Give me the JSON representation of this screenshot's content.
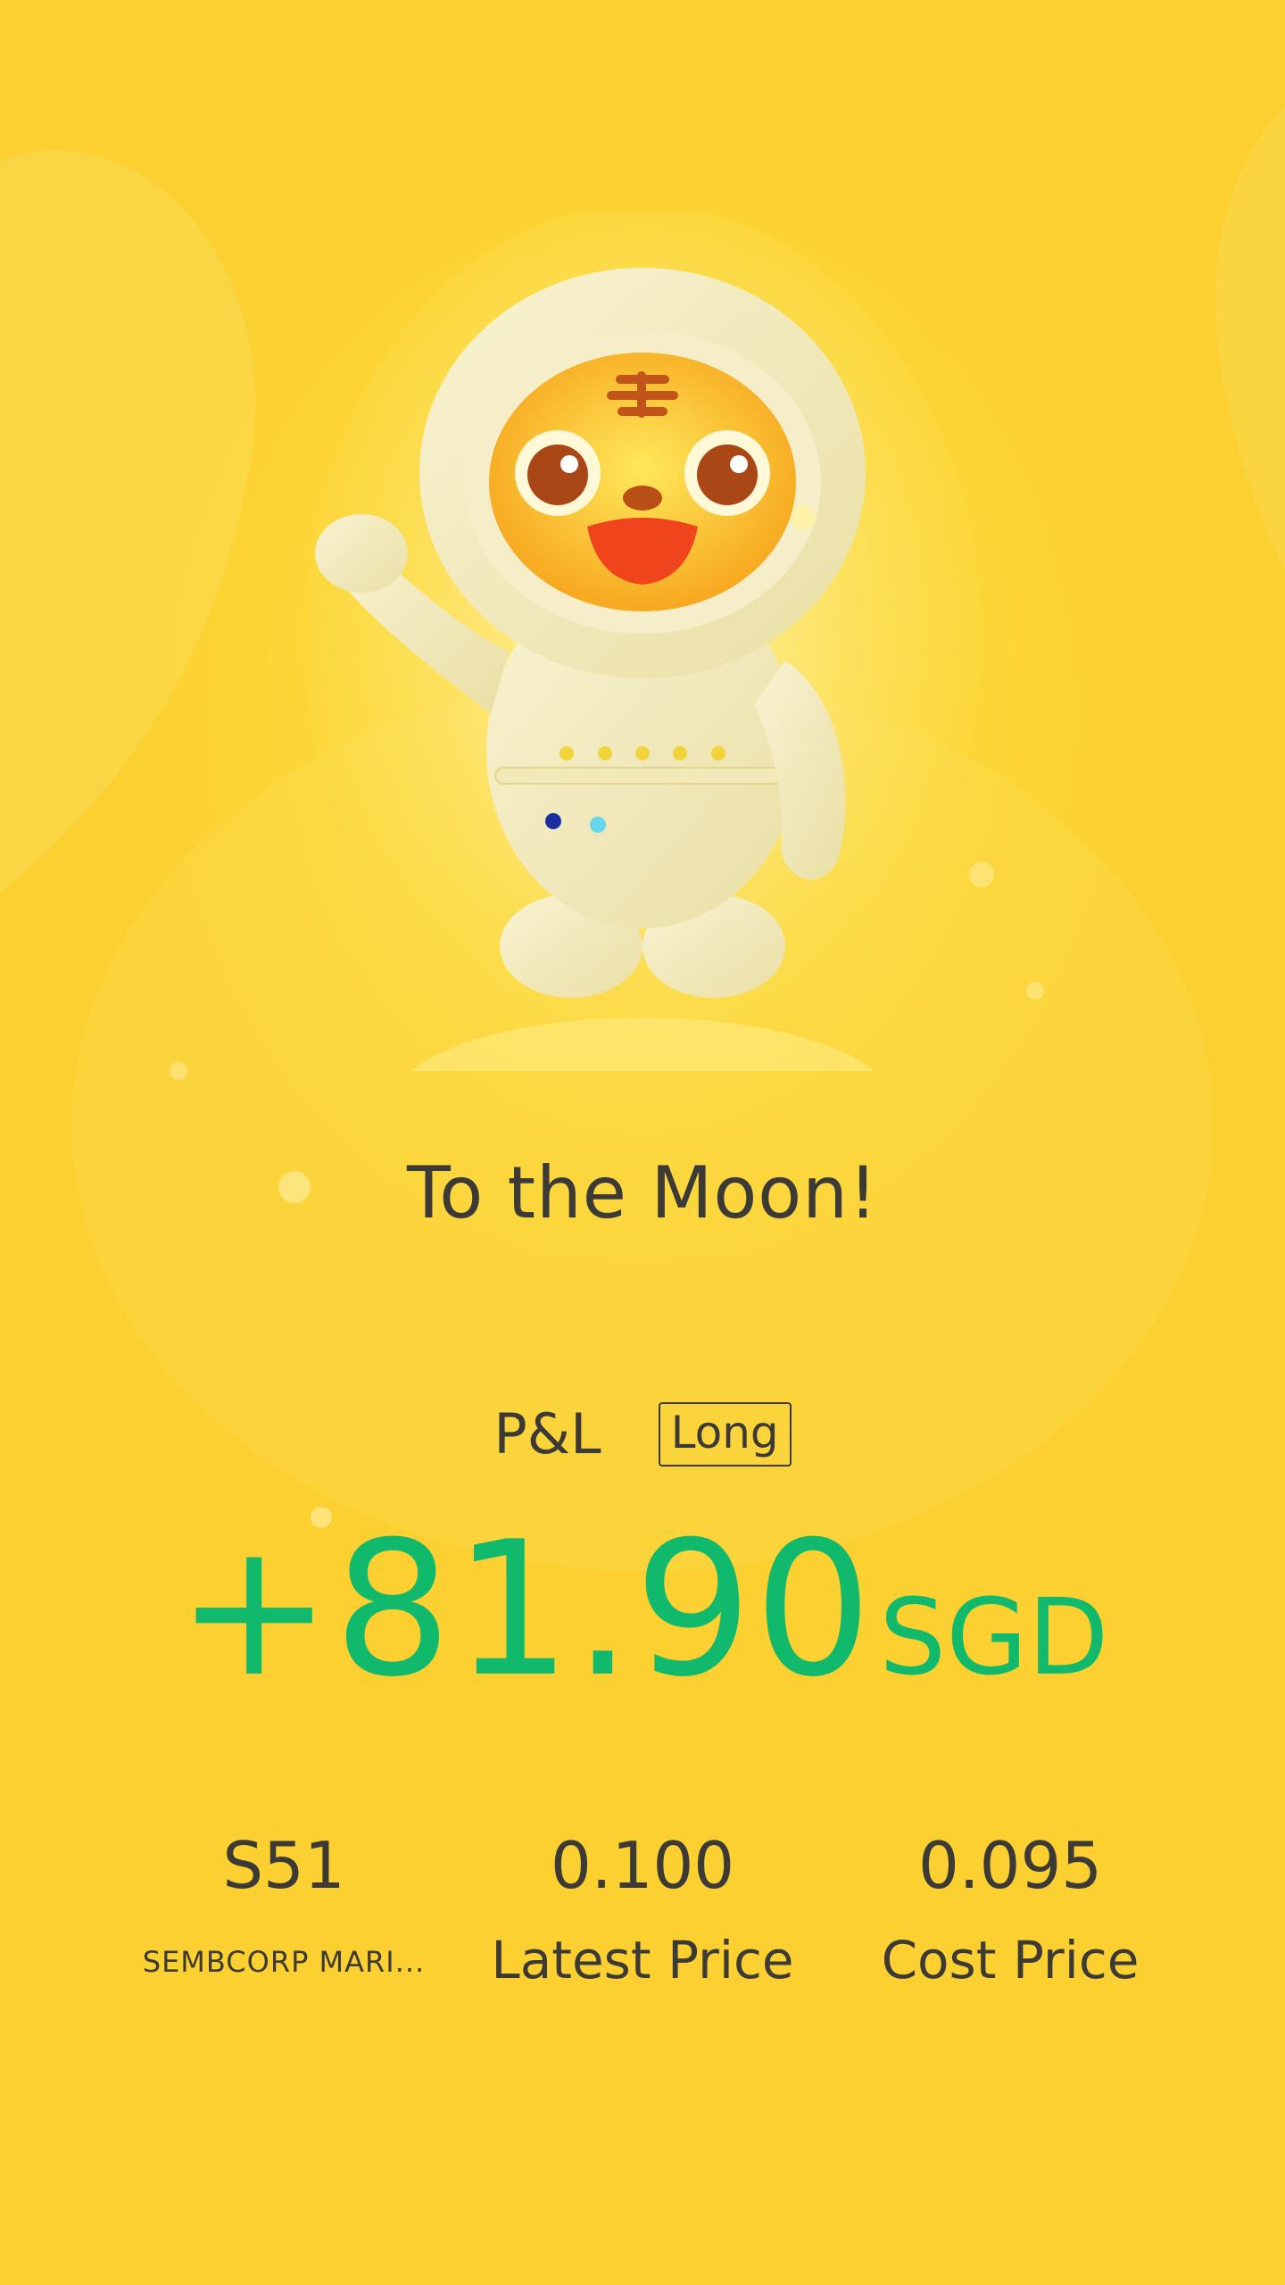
{
  "headline": "To the Moon!",
  "pnl": {
    "label": "P&L",
    "position_tag": "Long",
    "value": "+81.90",
    "currency": "SGD",
    "value_color": "#10b96c"
  },
  "stock": {
    "code": "S51",
    "name": "SEMBCORP MARI..."
  },
  "latest_price": {
    "value": "0.100",
    "label": "Latest Price"
  },
  "cost_price": {
    "value": "0.095",
    "label": "Cost Price"
  },
  "colors": {
    "background": "#fcd433",
    "text": "#3b3a36",
    "profit": "#10b96c"
  },
  "mascot": {
    "icon": "tiger-astronaut-mascot"
  }
}
